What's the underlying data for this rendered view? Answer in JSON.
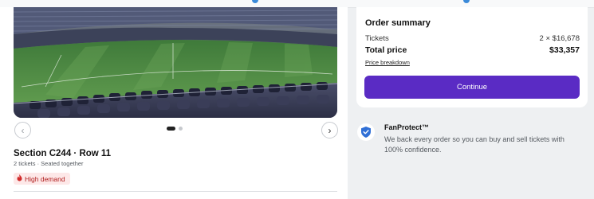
{
  "gallery": {
    "prev_icon": "chevron-left-icon",
    "next_icon": "chevron-right-icon",
    "prev_glyph": "‹",
    "next_glyph": "›"
  },
  "listing": {
    "title": "Section C244 · Row 11",
    "subtitle": "2 tickets · Seated together",
    "badge_icon": "flame-icon",
    "badge_label": "High demand"
  },
  "order_summary": {
    "title": "Order summary",
    "tickets_label": "Tickets",
    "tickets_value": "2 × $16,678",
    "total_label": "Total price",
    "total_value": "$33,357",
    "breakdown_link": "Price breakdown",
    "continue_label": "Continue"
  },
  "fanprotect": {
    "icon": "shield-check-icon",
    "title": "FanProtect™",
    "description": "We back every order so you can buy and sell tickets with 100% confidence."
  },
  "colors": {
    "accent": "#5a2bc4",
    "badge_bg": "#fde8e8",
    "badge_text": "#b01d1d",
    "shield": "#2f6fd6"
  }
}
